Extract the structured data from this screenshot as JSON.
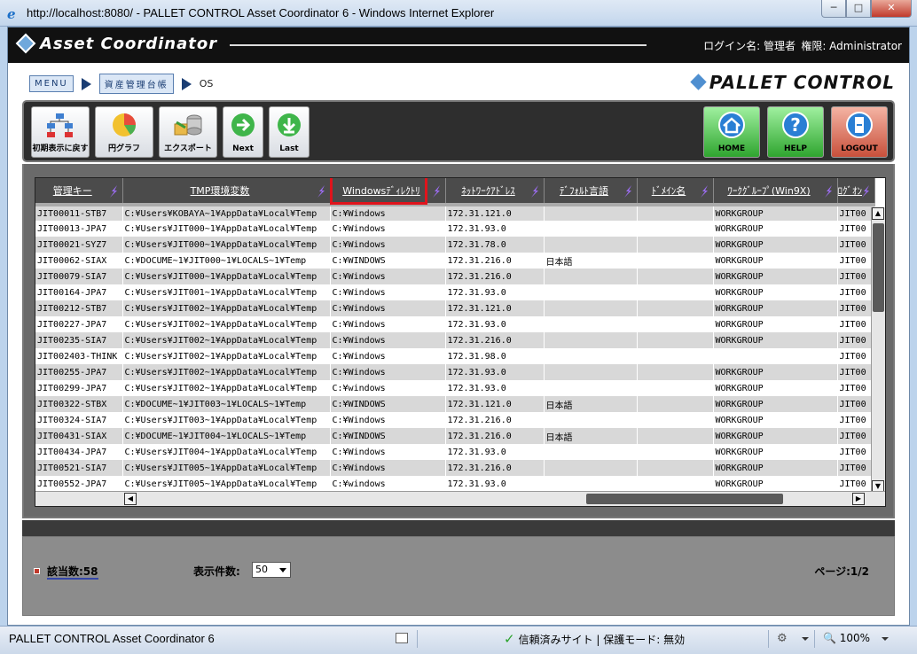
{
  "window": {
    "title": "http://localhost:8080/ - PALLET CONTROL Asset Coordinator 6 - Windows Internet Explorer",
    "minimize": "─",
    "maximize": "□",
    "close": "✕"
  },
  "header": {
    "logo": "Asset Coordinator",
    "login": "ログイン名: 管理者",
    "role": "権限: Administrator"
  },
  "breadcrumb": {
    "menu": "MENU",
    "section": "資産管理台帳",
    "current": "OS"
  },
  "brand": "PALLET CONTROL",
  "toolbar": {
    "reset_label": "初期表示に戻す",
    "pie_label": "円グラフ",
    "export_label": "エクスポート",
    "next_label": "Next",
    "last_label": "Last",
    "home_label": "HOME",
    "help_label": "HELP",
    "logout_label": "LOGOUT"
  },
  "grid": {
    "columns": [
      "管理キー",
      "TMP環境変数",
      "Windowsﾃﾞｨﾚｸﾄﾘ",
      "ﾈｯﾄﾜｰｸｱﾄﾞﾚｽ",
      "ﾃﾞﾌｫﾙﾄ言語",
      "ﾄﾞﾒｲﾝ名",
      "ﾜｰｸｸﾞﾙｰﾌﾟ(Win9X)",
      "ﾛｸﾞｵﾝ"
    ],
    "rows": [
      [
        "JIT00011-STB7",
        "C:¥Users¥KOBAYA~1¥AppData¥Local¥Temp",
        "C:¥Windows",
        "172.31.121.0",
        "",
        "",
        "WORKGROUP",
        "JIT00"
      ],
      [
        "JIT00013-JPA7",
        "C:¥Users¥JIT000~1¥AppData¥Local¥Temp",
        "C:¥Windows",
        "172.31.93.0",
        "",
        "",
        "WORKGROUP",
        "JIT00"
      ],
      [
        "JIT00021-SYZ7",
        "C:¥Users¥JIT000~1¥AppData¥Local¥Temp",
        "C:¥Windows",
        "172.31.78.0",
        "",
        "",
        "WORKGROUP",
        "JIT00"
      ],
      [
        "JIT00062-SIAX",
        "C:¥DOCUME~1¥JIT000~1¥LOCALS~1¥Temp",
        "C:¥WINDOWS",
        "172.31.216.0",
        "日本語",
        "",
        "WORKGROUP",
        "JIT00"
      ],
      [
        "JIT00079-SIA7",
        "C:¥Users¥JIT000~1¥AppData¥Local¥Temp",
        "C:¥Windows",
        "172.31.216.0",
        "",
        "",
        "WORKGROUP",
        "JIT00"
      ],
      [
        "JIT00164-JPA7",
        "C:¥Users¥JIT001~1¥AppData¥Local¥Temp",
        "C:¥Windows",
        "172.31.93.0",
        "",
        "",
        "WORKGROUP",
        "JIT00"
      ],
      [
        "JIT00212-STB7",
        "C:¥Users¥JIT002~1¥AppData¥Local¥Temp",
        "C:¥Windows",
        "172.31.121.0",
        "",
        "",
        "WORKGROUP",
        "JIT00"
      ],
      [
        "JIT00227-JPA7",
        "C:¥Users¥JIT002~1¥AppData¥Local¥Temp",
        "C:¥Windows",
        "172.31.93.0",
        "",
        "",
        "WORKGROUP",
        "JIT00"
      ],
      [
        "JIT00235-SIA7",
        "C:¥Users¥JIT002~1¥AppData¥Local¥Temp",
        "C:¥Windows",
        "172.31.216.0",
        "",
        "",
        "WORKGROUP",
        "JIT00"
      ],
      [
        "JIT002403-THINK",
        "C:¥Users¥JIT002~1¥AppData¥Local¥Temp",
        "C:¥Windows",
        "172.31.98.0",
        "",
        "",
        "",
        "JIT00"
      ],
      [
        "JIT00255-JPA7",
        "C:¥Users¥JIT002~1¥AppData¥Local¥Temp",
        "C:¥Windows",
        "172.31.93.0",
        "",
        "",
        "WORKGROUP",
        "JIT00"
      ],
      [
        "JIT00299-JPA7",
        "C:¥Users¥JIT002~1¥AppData¥Local¥Temp",
        "C:¥windows",
        "172.31.93.0",
        "",
        "",
        "WORKGROUP",
        "JIT00"
      ],
      [
        "JIT00322-STBX",
        "C:¥DOCUME~1¥JIT003~1¥LOCALS~1¥Temp",
        "C:¥WINDOWS",
        "172.31.121.0",
        "日本語",
        "",
        "WORKGROUP",
        "JIT00"
      ],
      [
        "JIT00324-SIA7",
        "C:¥Users¥JIT003~1¥AppData¥Local¥Temp",
        "C:¥Windows",
        "172.31.216.0",
        "",
        "",
        "WORKGROUP",
        "JIT00"
      ],
      [
        "JIT00431-SIAX",
        "C:¥DOCUME~1¥JIT004~1¥LOCALS~1¥Temp",
        "C:¥WINDOWS",
        "172.31.216.0",
        "日本語",
        "",
        "WORKGROUP",
        "JIT00"
      ],
      [
        "JIT00434-JPA7",
        "C:¥Users¥JIT004~1¥AppData¥Local¥Temp",
        "C:¥Windows",
        "172.31.93.0",
        "",
        "",
        "WORKGROUP",
        "JIT00"
      ],
      [
        "JIT00521-SIA7",
        "C:¥Users¥JIT005~1¥AppData¥Local¥Temp",
        "C:¥Windows",
        "172.31.216.0",
        "",
        "",
        "WORKGROUP",
        "JIT00"
      ],
      [
        "JIT00552-JPA7",
        "C:¥Users¥JIT005~1¥AppData¥Local¥Temp",
        "C:¥windows",
        "172.31.93.0",
        "",
        "",
        "WORKGROUP",
        "JIT00"
      ]
    ]
  },
  "footer": {
    "count_label": "該当数:58",
    "per_page_label": "表示件数:",
    "per_page_value": "50",
    "page_info": "ページ:1/2"
  },
  "statusbar": {
    "app": "PALLET CONTROL Asset Coordinator 6",
    "trust": "信頼済みサイト | 保護モード: 無効",
    "zoom": "100%"
  }
}
